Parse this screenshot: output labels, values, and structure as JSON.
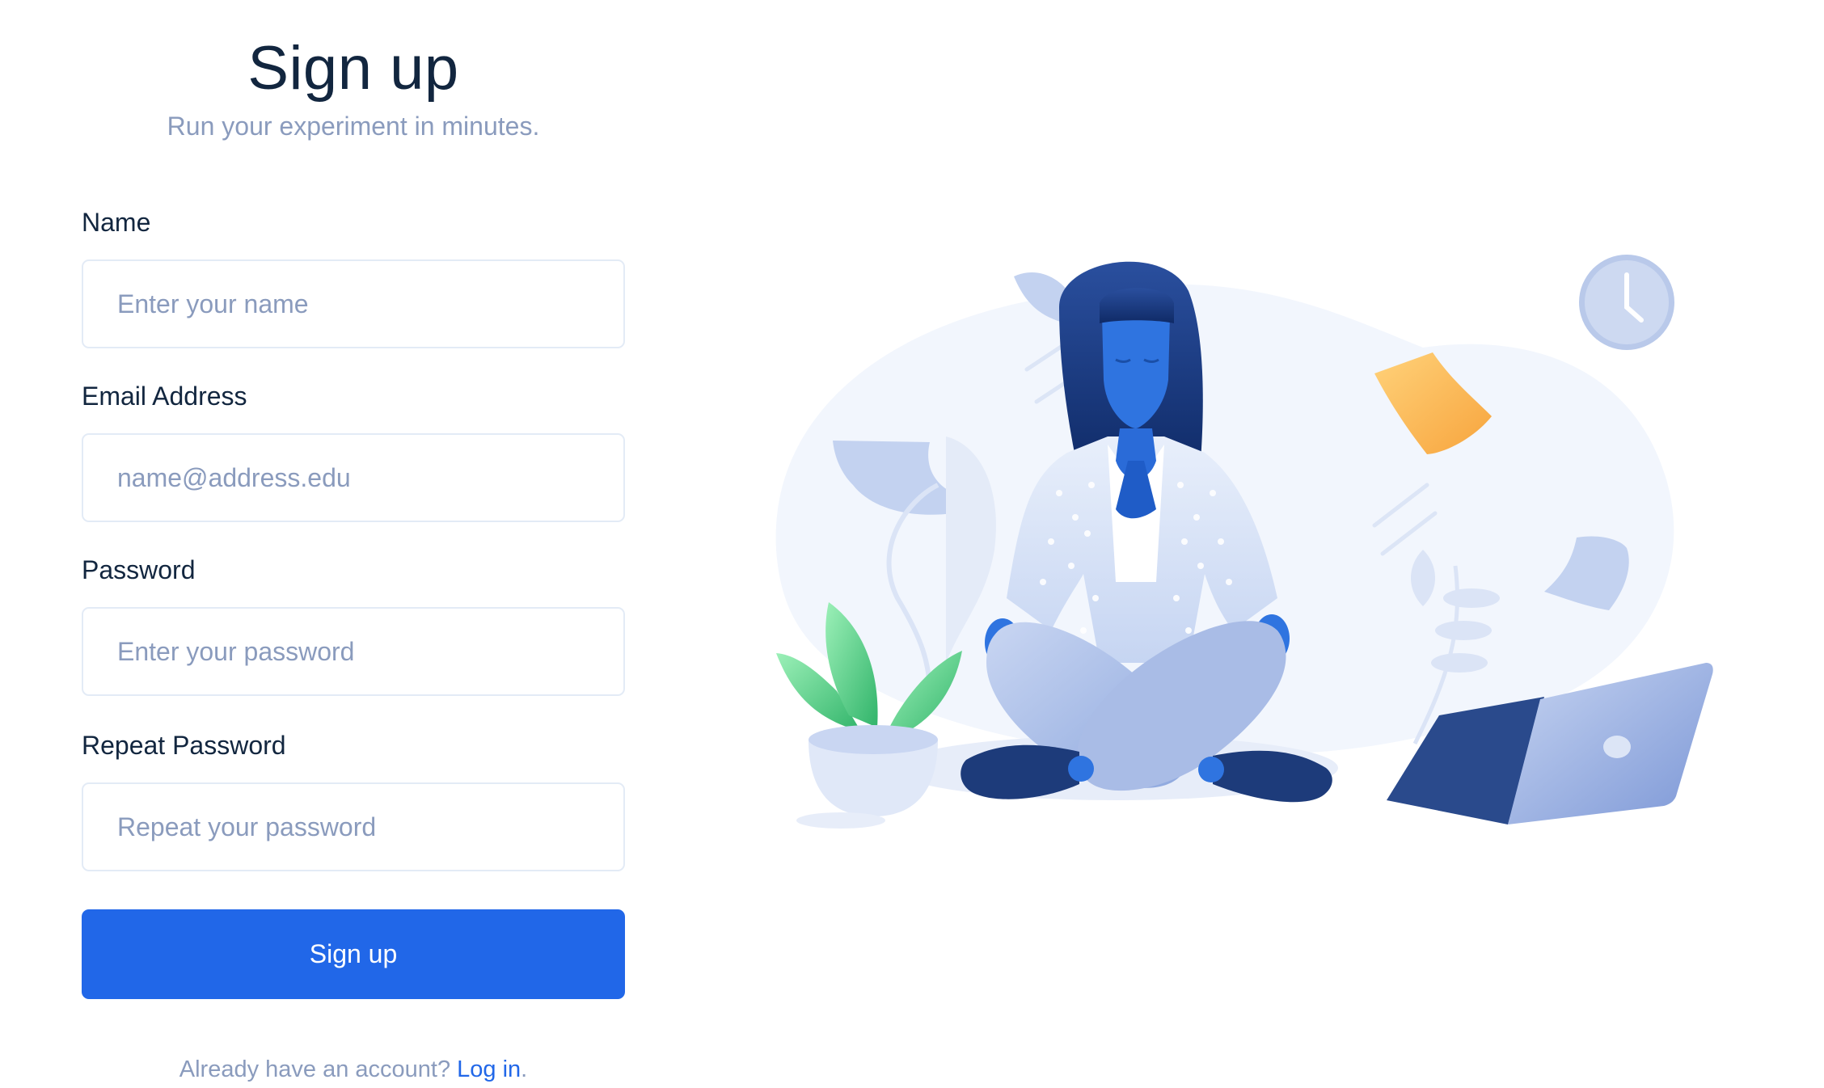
{
  "header": {
    "title": "Sign up",
    "subtitle": "Run your experiment in minutes."
  },
  "form": {
    "name": {
      "label": "Name",
      "placeholder": "Enter your name",
      "value": ""
    },
    "email": {
      "label": "Email Address",
      "placeholder": "name@address.edu",
      "value": ""
    },
    "password": {
      "label": "Password",
      "placeholder": "Enter your password",
      "value": ""
    },
    "repeat_password": {
      "label": "Repeat Password",
      "placeholder": "Repeat your password",
      "value": ""
    },
    "submit_label": "Sign up"
  },
  "footer": {
    "prompt": "Already have an account?",
    "link_label": "Log in",
    "suffix": "."
  },
  "illustration": {
    "icon": "meditating-person-illustration"
  },
  "colors": {
    "primary": "#2167e8",
    "heading": "#12263f",
    "muted": "#8a9bbd",
    "border": "#e3ebf6"
  }
}
